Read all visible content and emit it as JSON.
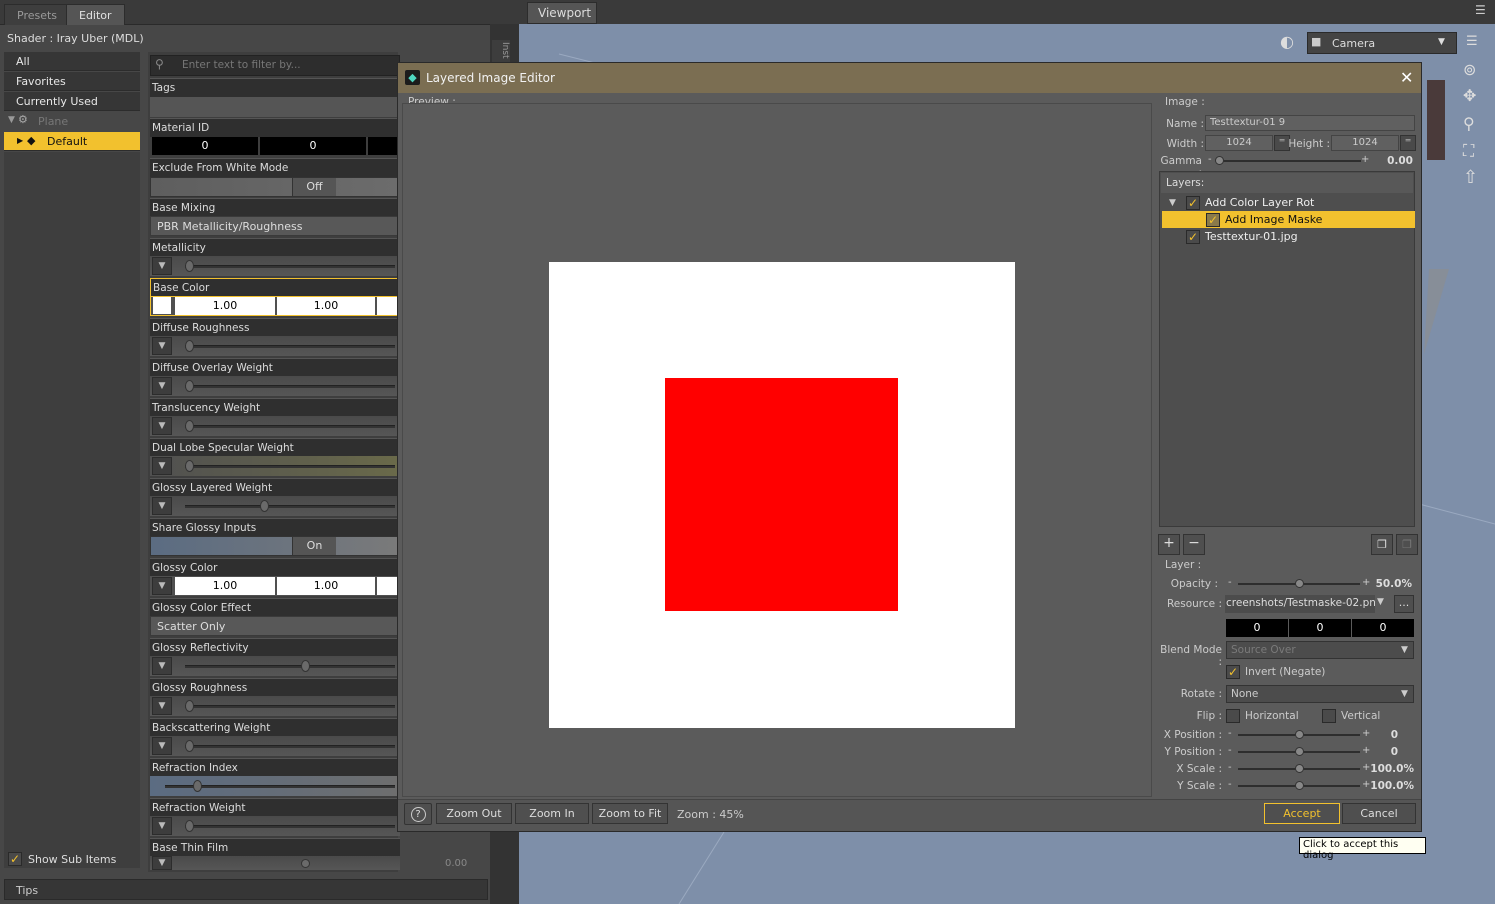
{
  "left_tabs": [
    "Presets",
    "Editor"
  ],
  "shader_line": "Shader :  Iray Uber (MDL)",
  "filter_placeholder": "Enter text to filter by...",
  "categories": [
    "All",
    "Favorites",
    "Currently Used"
  ],
  "tree": {
    "plane": "Plane",
    "default": "Default"
  },
  "properties": {
    "tags": "Tags",
    "material_id": "Material ID",
    "material_id_vals": [
      "0",
      "0"
    ],
    "exclude_white": "Exclude From White Mode",
    "exclude_white_val": "Off",
    "base_mixing": "Base Mixing",
    "base_mixing_val": "PBR Metallicity/Roughness",
    "metallicity": "Metallicity",
    "base_color": "Base Color",
    "base_color_vals": [
      "1.00",
      "1.00"
    ],
    "diffuse_roughness": "Diffuse Roughness",
    "diffuse_overlay": "Diffuse Overlay Weight",
    "translucency": "Translucency Weight",
    "dual_lobe": "Dual Lobe Specular Weight",
    "glossy_layered": "Glossy Layered Weight",
    "share_glossy": "Share Glossy Inputs",
    "share_glossy_val": "On",
    "glossy_color": "Glossy Color",
    "glossy_color_vals": [
      "1.00",
      "1.00"
    ],
    "glossy_color_effect": "Glossy Color Effect",
    "glossy_color_effect_val": "Scatter Only",
    "glossy_reflectivity": "Glossy Reflectivity",
    "glossy_roughness": "Glossy Roughness",
    "backscattering": "Backscattering Weight",
    "refraction_index": "Refraction Index",
    "refraction_weight": "Refraction Weight",
    "base_thin_film": "Base Thin Film",
    "base_thin_film_val": "0.00"
  },
  "show_sub_items": "Show Sub Items",
  "tips": "Tips",
  "side_tab": "Inst",
  "viewport": {
    "tab": "Viewport",
    "camera": "Camera"
  },
  "dialog": {
    "title": "Layered Image Editor",
    "preview_label": "Preview :",
    "image_section": "Image :",
    "name_label": "Name :",
    "name_val": "Testtextur-01 9",
    "width_label": "Width :",
    "width_val": "1024",
    "height_label": "Height :",
    "height_val": "1024",
    "gamma_label": "Gamma :",
    "gamma_val": "0.00",
    "layers_label": "Layers:",
    "layers": [
      "Add Color Layer Rot",
      "Add Image Maske",
      "Testtextur-01.jpg"
    ],
    "layer_section": "Layer :",
    "opacity_label": "Opacity :",
    "opacity_val": "50.0%",
    "resource_label": "Resource :",
    "resource_val": "creenshots/Testmaske-02.png",
    "rgb_vals": [
      "0",
      "0",
      "0"
    ],
    "blend_label": "Blend Mode :",
    "blend_val": "Source Over",
    "invert_label": "Invert (Negate)",
    "rotate_label": "Rotate :",
    "rotate_val": "None",
    "flip_label": "Flip :",
    "flip_h": "Horizontal",
    "flip_v": "Vertical",
    "xpos_label": "X Position :",
    "xpos_val": "0",
    "ypos_label": "Y Position :",
    "ypos_val": "0",
    "xscale_label": "X Scale :",
    "xscale_val": "100.0%",
    "yscale_label": "Y Scale :",
    "yscale_val": "100.0%",
    "zoom_out": "Zoom Out",
    "zoom_in": "Zoom In",
    "zoom_fit": "Zoom to Fit",
    "zoom_level": "Zoom : 45%",
    "accept": "Accept",
    "cancel": "Cancel",
    "tooltip": "Click to accept this dialog"
  },
  "colors": {
    "accent": "#f2c12e",
    "title_bar": "#7b6e52",
    "viewport": "#7e8fa9",
    "red": "#ff0000"
  }
}
